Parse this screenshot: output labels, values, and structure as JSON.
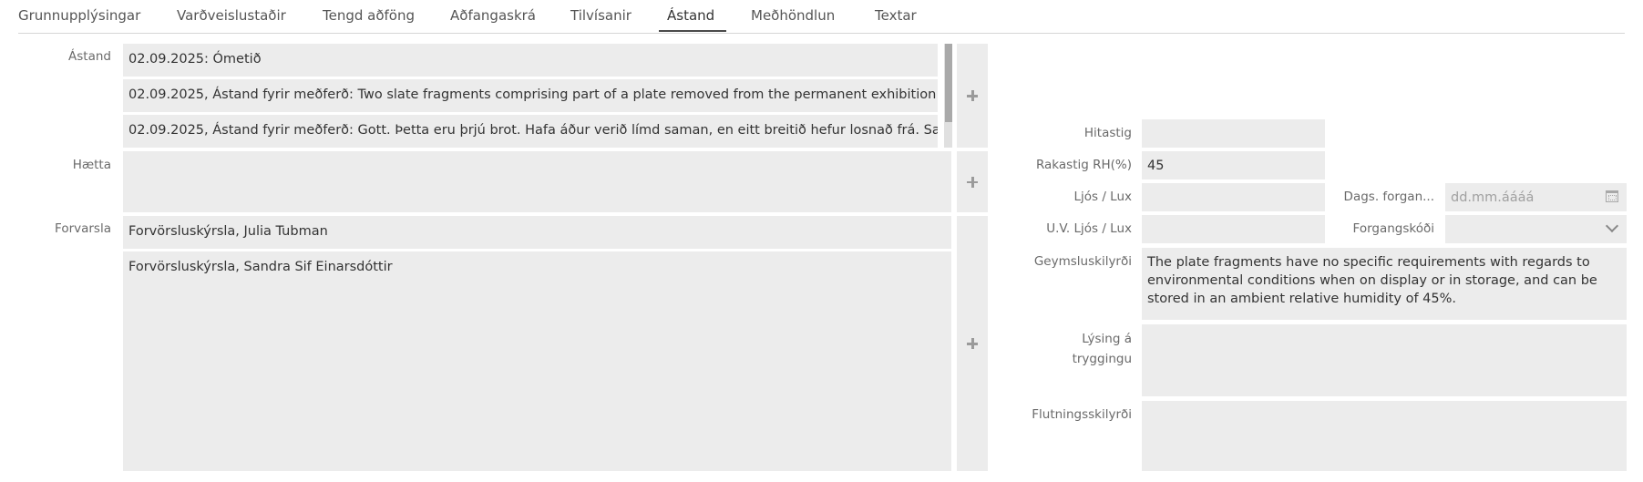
{
  "tabs": [
    {
      "label": "Grunnupplýsingar"
    },
    {
      "label": "Varðveislustaðir"
    },
    {
      "label": "Tengd aðföng"
    },
    {
      "label": "Aðfangaskrá"
    },
    {
      "label": "Tilvísanir"
    },
    {
      "label": "Ástand"
    },
    {
      "label": "Meðhöndlun"
    },
    {
      "label": "Textar"
    }
  ],
  "active_tab": "Ástand",
  "condition": {
    "label": "Ástand",
    "rows": [
      "02.09.2025: Ómetið",
      "02.09.2025, Ástand fyrir meðferð: Two slate fragments comprising part of a plate removed from the permanent exhibition af",
      "02.09.2025, Ástand fyrir meðferð: Gott. Þetta eru þrjú brot. Hafa áður verið límd saman, en eitt breitið hefur losnað frá. Sagæ"
    ]
  },
  "hazard": {
    "label": "Hætta"
  },
  "conservation": {
    "label": "Forvarsla",
    "rows": [
      "Forvörsluskýrsla, Julia Tubman",
      "Forvörsluskýrsla, Sandra Sif Einarsdóttir"
    ]
  },
  "environment": {
    "temperature": {
      "label": "Hitastig",
      "value": ""
    },
    "humidity": {
      "label": "Rakastig RH(%)",
      "value": "45"
    },
    "light": {
      "label": "Ljós / Lux",
      "value": ""
    },
    "uv_light": {
      "label": "U.V. Ljós / Lux",
      "value": ""
    },
    "priority_date": {
      "label": "Dags. forgan...",
      "placeholder": "dd.mm.áááá"
    },
    "priority_code": {
      "label": "Forgangskóði",
      "value": ""
    },
    "storage": {
      "label": "Geymsluskilyrði",
      "value": "The plate fragments have no specific requirements with regards to environmental conditions when on display or in storage, and can be stored in an ambient relative humidity of 45%."
    },
    "insurance": {
      "label_line1": "Lýsing á",
      "label_line2": "tryggingu",
      "value": ""
    },
    "transport": {
      "label": "Flutningsskilyrði",
      "value": ""
    }
  },
  "icons": {
    "add": "plus-icon",
    "calendar": "calendar-icon",
    "dropdown": "chevron-down-icon"
  }
}
